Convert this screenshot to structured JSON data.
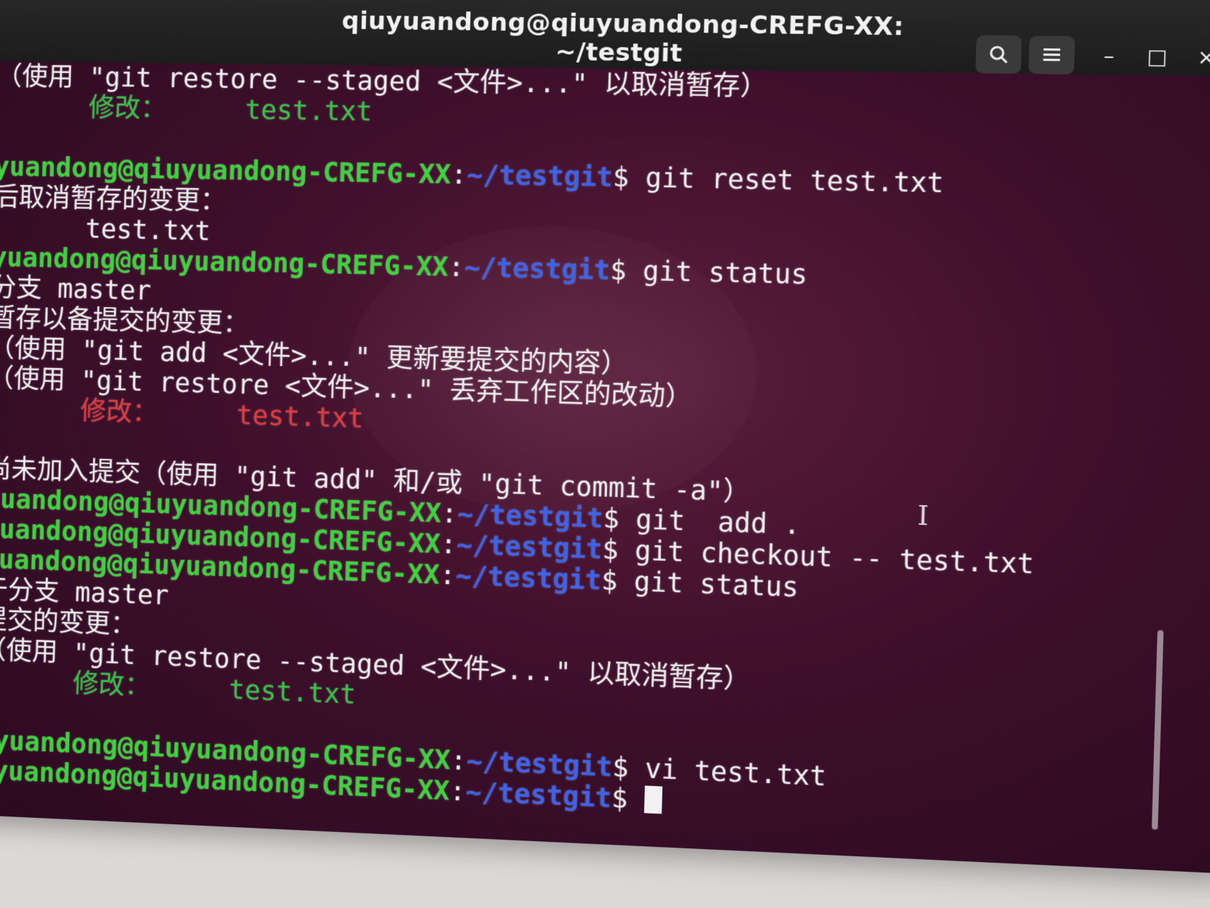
{
  "window": {
    "title": "qiuyuandong@qiuyuandong-CREFG-XX: ~/testgit",
    "buttons": {
      "search_icon": "search-icon",
      "menu_icon": "hamburger-menu-icon",
      "minimize": "–",
      "maximize": "□",
      "close": "×"
    }
  },
  "terminal": {
    "lines": [
      {
        "segments": [
          {
            "text": "（使用 \"git restore --staged <文件>...\" 以取消暂存）",
            "style": "white"
          }
        ]
      },
      {
        "segments": [
          {
            "text": "      修改：     test.txt",
            "style": "teal"
          }
        ]
      },
      {
        "segments": [
          {
            "text": "",
            "style": "white"
          }
        ]
      },
      {
        "segments": [
          {
            "text": "yuandong@qiuyuandong-CREFG-XX",
            "style": "green"
          },
          {
            "text": ":",
            "style": "white"
          },
          {
            "text": "~/testgit",
            "style": "blue"
          },
          {
            "text": "$ git reset test.txt",
            "style": "white"
          }
        ]
      },
      {
        "segments": [
          {
            "text": "后取消暂存的变更：",
            "style": "white"
          }
        ]
      },
      {
        "segments": [
          {
            "text": "      test.txt",
            "style": "white"
          }
        ]
      },
      {
        "segments": [
          {
            "text": "yuandong@qiuyuandong-CREFG-XX",
            "style": "green"
          },
          {
            "text": ":",
            "style": "white"
          },
          {
            "text": "~/testgit",
            "style": "blue"
          },
          {
            "text": "$ git status",
            "style": "white"
          }
        ]
      },
      {
        "segments": [
          {
            "text": "分支 master",
            "style": "white"
          }
        ]
      },
      {
        "segments": [
          {
            "text": "暂存以备提交的变更：",
            "style": "white"
          }
        ]
      },
      {
        "segments": [
          {
            "text": "（使用 \"git add <文件>...\" 更新要提交的内容）",
            "style": "white"
          }
        ]
      },
      {
        "segments": [
          {
            "text": "（使用 \"git restore <文件>...\" 丢弃工作区的改动）",
            "style": "white"
          }
        ]
      },
      {
        "segments": [
          {
            "text": "      修改：     test.txt",
            "style": "red"
          }
        ]
      },
      {
        "segments": [
          {
            "text": "",
            "style": "white"
          }
        ]
      },
      {
        "segments": [
          {
            "text": "尚未加入提交（使用 \"git add\" 和/或 \"git commit -a\"）",
            "style": "white"
          }
        ]
      },
      {
        "segments": [
          {
            "text": "yuandong@qiuyuandong-CREFG-XX",
            "style": "green"
          },
          {
            "text": ":",
            "style": "white"
          },
          {
            "text": "~/testgit",
            "style": "blue"
          },
          {
            "text": "$ git  add .",
            "style": "white"
          }
        ]
      },
      {
        "segments": [
          {
            "text": "yuandong@qiuyuandong-CREFG-XX",
            "style": "green"
          },
          {
            "text": ":",
            "style": "white"
          },
          {
            "text": "~/testgit",
            "style": "blue"
          },
          {
            "text": "$ git checkout -- test.txt",
            "style": "white"
          }
        ]
      },
      {
        "segments": [
          {
            "text": "yuandong@qiuyuandong-CREFG-XX",
            "style": "green"
          },
          {
            "text": ":",
            "style": "white"
          },
          {
            "text": "~/testgit",
            "style": "blue"
          },
          {
            "text": "$ git status",
            "style": "white"
          }
        ]
      },
      {
        "segments": [
          {
            "text": "于分支 master",
            "style": "white"
          }
        ]
      },
      {
        "segments": [
          {
            "text": "提交的变更：",
            "style": "white"
          }
        ]
      },
      {
        "segments": [
          {
            "text": "（使用 \"git restore --staged <文件>...\" 以取消暂存）",
            "style": "white"
          }
        ]
      },
      {
        "segments": [
          {
            "text": "      修改：     test.txt",
            "style": "teal"
          }
        ]
      },
      {
        "segments": [
          {
            "text": "",
            "style": "white"
          }
        ]
      },
      {
        "segments": [
          {
            "text": "uyuandong@qiuyuandong-CREFG-XX",
            "style": "green"
          },
          {
            "text": ":",
            "style": "white"
          },
          {
            "text": "~/testgit",
            "style": "blue"
          },
          {
            "text": "$ vi test.txt",
            "style": "white"
          }
        ]
      },
      {
        "segments": [
          {
            "text": "uyuandong@qiuyuandong-CREFG-XX",
            "style": "green"
          },
          {
            "text": ":",
            "style": "white"
          },
          {
            "text": "~/testgit",
            "style": "blue"
          },
          {
            "text": "$ ",
            "style": "white"
          }
        ],
        "cursor": true
      }
    ]
  },
  "colors": {
    "prompt_user": "#3fd13f",
    "prompt_path": "#3e63e6",
    "modified_unstaged": "#e23b3b",
    "modified_staged": "#35c447",
    "background": "#3f0f2c"
  }
}
